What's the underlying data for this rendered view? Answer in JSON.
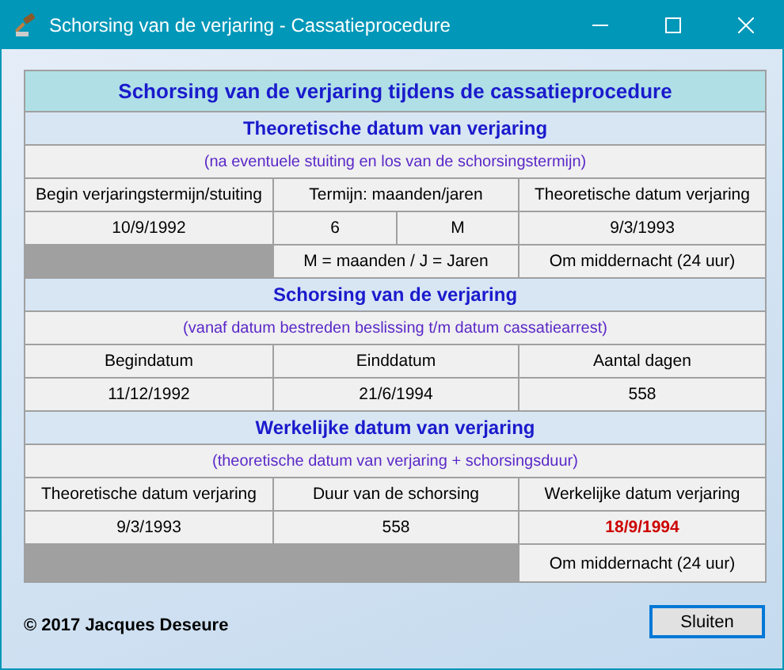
{
  "window": {
    "title": "Schorsing van de verjaring - Cassatieprocedure"
  },
  "title": "Schorsing van de verjaring tijdens de cassatieprocedure",
  "sections": [
    {
      "heading": "Theoretische datum van verjaring",
      "subheading": "(na eventuele stuiting en los van de schorsingstermijn)",
      "rows": [
        [
          {
            "kind": "text",
            "text": "Begin verjaringstermijn/stuiting"
          },
          {
            "kind": "text",
            "text": "Termijn: maanden/jaren"
          },
          {
            "kind": "text",
            "text": "Theoretische datum verjaring"
          }
        ],
        [
          {
            "kind": "text",
            "text": "10/9/1992"
          },
          {
            "kind": "split",
            "text": "6",
            "unit": "M"
          },
          {
            "kind": "text",
            "text": "9/3/1993"
          }
        ],
        [
          {
            "kind": "blank"
          },
          {
            "kind": "text",
            "text": "M = maanden / J = Jaren"
          },
          {
            "kind": "text",
            "text": "Om middernacht (24 uur)"
          }
        ]
      ]
    },
    {
      "heading": "Schorsing van de verjaring",
      "subheading": "(vanaf datum bestreden beslissing t/m datum cassatiearrest)",
      "rows": [
        [
          {
            "kind": "text",
            "text": "Begindatum"
          },
          {
            "kind": "text",
            "text": "Einddatum"
          },
          {
            "kind": "text",
            "text": "Aantal dagen"
          }
        ],
        [
          {
            "kind": "text",
            "text": "11/12/1992"
          },
          {
            "kind": "text",
            "text": "21/6/1994"
          },
          {
            "kind": "text",
            "text": "558"
          }
        ]
      ]
    },
    {
      "heading": "Werkelijke datum van verjaring",
      "subheading": "(theoretische datum van verjaring + schorsingsduur)",
      "rows": [
        [
          {
            "kind": "text",
            "text": "Theoretische datum verjaring"
          },
          {
            "kind": "text",
            "text": "Duur van de schorsing"
          },
          {
            "kind": "text",
            "text": "Werkelijke datum verjaring"
          }
        ],
        [
          {
            "kind": "text",
            "text": "9/3/1993"
          },
          {
            "kind": "text",
            "text": "558"
          },
          {
            "kind": "result",
            "text": "18/9/1994"
          }
        ],
        [
          {
            "kind": "blank"
          },
          {
            "kind": "blank"
          },
          {
            "kind": "text",
            "text": "Om middernacht (24 uur)"
          }
        ]
      ]
    }
  ],
  "copyright": "© 2017 Jacques Deseure",
  "buttons": [
    "Sluiten"
  ]
}
